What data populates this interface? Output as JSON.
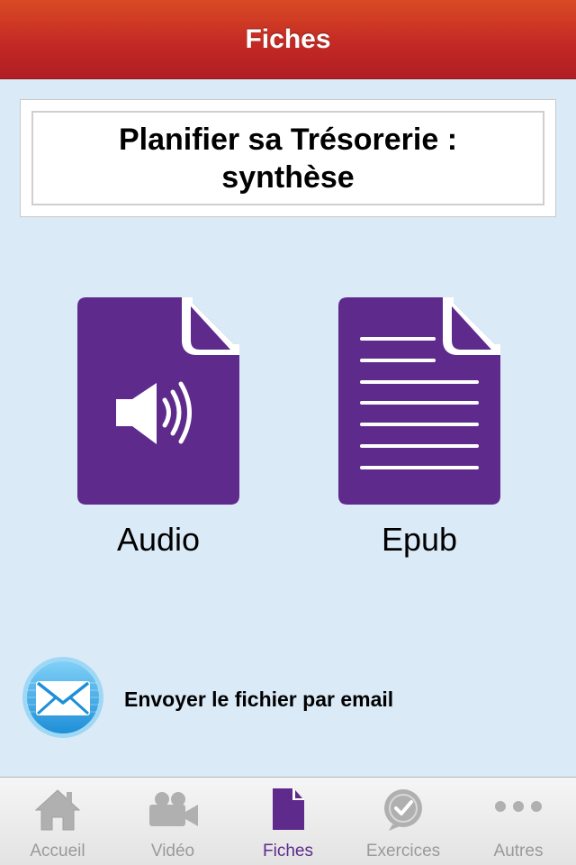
{
  "header": {
    "title": "Fiches"
  },
  "card": {
    "title": "Planifier sa Trésorerie : synthèse"
  },
  "files": [
    {
      "label": "Audio",
      "icon": "audio-file-icon"
    },
    {
      "label": "Epub",
      "icon": "document-file-icon"
    }
  ],
  "email": {
    "label": "Envoyer le fichier par email",
    "icon": "envelope-icon"
  },
  "tabs": [
    {
      "label": "Accueil",
      "icon": "home-icon",
      "active": false
    },
    {
      "label": "Vidéo",
      "icon": "video-camera-icon",
      "active": false
    },
    {
      "label": "Fiches",
      "icon": "document-icon",
      "active": true
    },
    {
      "label": "Exercices",
      "icon": "check-bubble-icon",
      "active": false
    },
    {
      "label": "Autres",
      "icon": "more-dots-icon",
      "active": false
    }
  ],
  "colors": {
    "header_red": "#c42a25",
    "accent_purple": "#5e2a8c",
    "background": "#dbeaf7",
    "inactive_tab": "#9a9a9a"
  }
}
